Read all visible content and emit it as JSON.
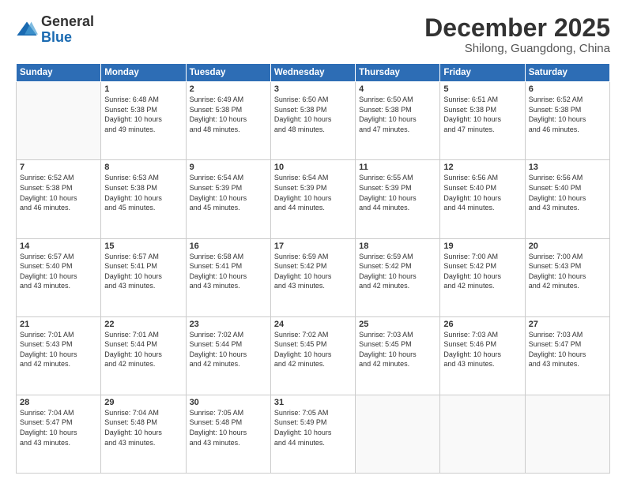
{
  "logo": {
    "general": "General",
    "blue": "Blue"
  },
  "title": "December 2025",
  "subtitle": "Shilong, Guangdong, China",
  "headers": [
    "Sunday",
    "Monday",
    "Tuesday",
    "Wednesday",
    "Thursday",
    "Friday",
    "Saturday"
  ],
  "weeks": [
    [
      {
        "day": "",
        "info": ""
      },
      {
        "day": "1",
        "info": "Sunrise: 6:48 AM\nSunset: 5:38 PM\nDaylight: 10 hours\nand 49 minutes."
      },
      {
        "day": "2",
        "info": "Sunrise: 6:49 AM\nSunset: 5:38 PM\nDaylight: 10 hours\nand 48 minutes."
      },
      {
        "day": "3",
        "info": "Sunrise: 6:50 AM\nSunset: 5:38 PM\nDaylight: 10 hours\nand 48 minutes."
      },
      {
        "day": "4",
        "info": "Sunrise: 6:50 AM\nSunset: 5:38 PM\nDaylight: 10 hours\nand 47 minutes."
      },
      {
        "day": "5",
        "info": "Sunrise: 6:51 AM\nSunset: 5:38 PM\nDaylight: 10 hours\nand 47 minutes."
      },
      {
        "day": "6",
        "info": "Sunrise: 6:52 AM\nSunset: 5:38 PM\nDaylight: 10 hours\nand 46 minutes."
      }
    ],
    [
      {
        "day": "7",
        "info": "Sunrise: 6:52 AM\nSunset: 5:38 PM\nDaylight: 10 hours\nand 46 minutes."
      },
      {
        "day": "8",
        "info": "Sunrise: 6:53 AM\nSunset: 5:38 PM\nDaylight: 10 hours\nand 45 minutes."
      },
      {
        "day": "9",
        "info": "Sunrise: 6:54 AM\nSunset: 5:39 PM\nDaylight: 10 hours\nand 45 minutes."
      },
      {
        "day": "10",
        "info": "Sunrise: 6:54 AM\nSunset: 5:39 PM\nDaylight: 10 hours\nand 44 minutes."
      },
      {
        "day": "11",
        "info": "Sunrise: 6:55 AM\nSunset: 5:39 PM\nDaylight: 10 hours\nand 44 minutes."
      },
      {
        "day": "12",
        "info": "Sunrise: 6:56 AM\nSunset: 5:40 PM\nDaylight: 10 hours\nand 44 minutes."
      },
      {
        "day": "13",
        "info": "Sunrise: 6:56 AM\nSunset: 5:40 PM\nDaylight: 10 hours\nand 43 minutes."
      }
    ],
    [
      {
        "day": "14",
        "info": "Sunrise: 6:57 AM\nSunset: 5:40 PM\nDaylight: 10 hours\nand 43 minutes."
      },
      {
        "day": "15",
        "info": "Sunrise: 6:57 AM\nSunset: 5:41 PM\nDaylight: 10 hours\nand 43 minutes."
      },
      {
        "day": "16",
        "info": "Sunrise: 6:58 AM\nSunset: 5:41 PM\nDaylight: 10 hours\nand 43 minutes."
      },
      {
        "day": "17",
        "info": "Sunrise: 6:59 AM\nSunset: 5:42 PM\nDaylight: 10 hours\nand 43 minutes."
      },
      {
        "day": "18",
        "info": "Sunrise: 6:59 AM\nSunset: 5:42 PM\nDaylight: 10 hours\nand 42 minutes."
      },
      {
        "day": "19",
        "info": "Sunrise: 7:00 AM\nSunset: 5:42 PM\nDaylight: 10 hours\nand 42 minutes."
      },
      {
        "day": "20",
        "info": "Sunrise: 7:00 AM\nSunset: 5:43 PM\nDaylight: 10 hours\nand 42 minutes."
      }
    ],
    [
      {
        "day": "21",
        "info": "Sunrise: 7:01 AM\nSunset: 5:43 PM\nDaylight: 10 hours\nand 42 minutes."
      },
      {
        "day": "22",
        "info": "Sunrise: 7:01 AM\nSunset: 5:44 PM\nDaylight: 10 hours\nand 42 minutes."
      },
      {
        "day": "23",
        "info": "Sunrise: 7:02 AM\nSunset: 5:44 PM\nDaylight: 10 hours\nand 42 minutes."
      },
      {
        "day": "24",
        "info": "Sunrise: 7:02 AM\nSunset: 5:45 PM\nDaylight: 10 hours\nand 42 minutes."
      },
      {
        "day": "25",
        "info": "Sunrise: 7:03 AM\nSunset: 5:45 PM\nDaylight: 10 hours\nand 42 minutes."
      },
      {
        "day": "26",
        "info": "Sunrise: 7:03 AM\nSunset: 5:46 PM\nDaylight: 10 hours\nand 43 minutes."
      },
      {
        "day": "27",
        "info": "Sunrise: 7:03 AM\nSunset: 5:47 PM\nDaylight: 10 hours\nand 43 minutes."
      }
    ],
    [
      {
        "day": "28",
        "info": "Sunrise: 7:04 AM\nSunset: 5:47 PM\nDaylight: 10 hours\nand 43 minutes."
      },
      {
        "day": "29",
        "info": "Sunrise: 7:04 AM\nSunset: 5:48 PM\nDaylight: 10 hours\nand 43 minutes."
      },
      {
        "day": "30",
        "info": "Sunrise: 7:05 AM\nSunset: 5:48 PM\nDaylight: 10 hours\nand 43 minutes."
      },
      {
        "day": "31",
        "info": "Sunrise: 7:05 AM\nSunset: 5:49 PM\nDaylight: 10 hours\nand 44 minutes."
      },
      {
        "day": "",
        "info": ""
      },
      {
        "day": "",
        "info": ""
      },
      {
        "day": "",
        "info": ""
      }
    ]
  ]
}
